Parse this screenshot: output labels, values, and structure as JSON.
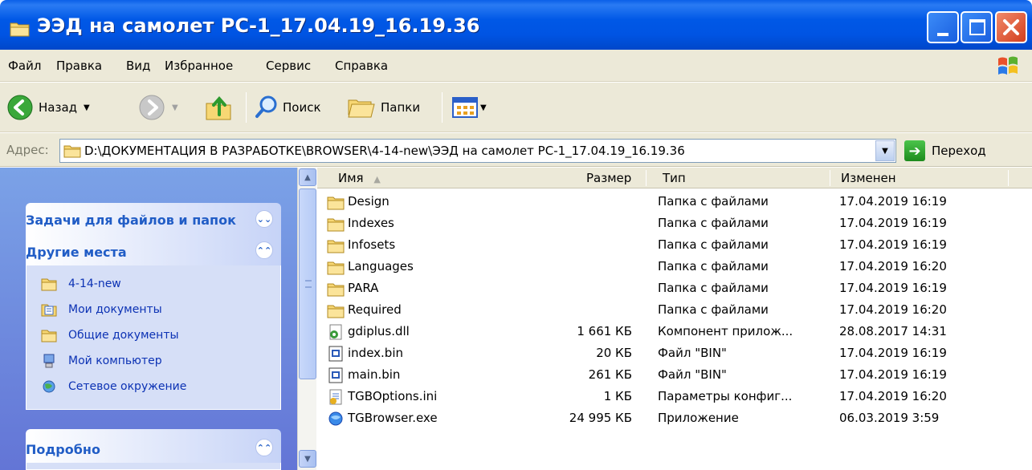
{
  "window": {
    "title": "ЭЭД на самолет РС-1_17.04.19_16.19.36"
  },
  "menu": [
    "Файл",
    "Правка",
    "Вид",
    "Избранное",
    "Сервис",
    "Справка"
  ],
  "toolbar": {
    "back_label": "Назад",
    "search_label": "Поиск",
    "folders_label": "Папки"
  },
  "address": {
    "label": "Адрес:",
    "path": "D:\\ДОКУМЕНТАЦИЯ В РАЗРАБОТКЕ\\BROWSER\\4-14-new\\ЭЭД на самолет РС-1_17.04.19_16.19.36",
    "go_label": "Переход"
  },
  "taskpane": {
    "file_tasks_title": "Задачи для файлов и папок",
    "other_places_title": "Другие места",
    "other_places": [
      {
        "label": "4-14-new",
        "icon": "folder-icon"
      },
      {
        "label": "Мои документы",
        "icon": "my-documents-icon"
      },
      {
        "label": "Общие документы",
        "icon": "folder-icon"
      },
      {
        "label": "Мой компьютер",
        "icon": "my-computer-icon"
      },
      {
        "label": "Сетевое окружение",
        "icon": "network-icon"
      }
    ],
    "details_title": "Подробно"
  },
  "columns": {
    "name": "Имя",
    "size": "Размер",
    "type": "Тип",
    "modified": "Изменен"
  },
  "files": [
    {
      "name": "Design",
      "size": "",
      "type": "Папка с файлами",
      "modified": "17.04.2019 16:19",
      "icon": "folder-icon"
    },
    {
      "name": "Indexes",
      "size": "",
      "type": "Папка с файлами",
      "modified": "17.04.2019 16:19",
      "icon": "folder-icon"
    },
    {
      "name": "Infosets",
      "size": "",
      "type": "Папка с файлами",
      "modified": "17.04.2019 16:19",
      "icon": "folder-icon"
    },
    {
      "name": "Languages",
      "size": "",
      "type": "Папка с файлами",
      "modified": "17.04.2019 16:20",
      "icon": "folder-icon"
    },
    {
      "name": "PARA",
      "size": "",
      "type": "Папка с файлами",
      "modified": "17.04.2019 16:19",
      "icon": "folder-icon"
    },
    {
      "name": "Required",
      "size": "",
      "type": "Папка с файлами",
      "modified": "17.04.2019 16:20",
      "icon": "folder-icon"
    },
    {
      "name": "gdiplus.dll",
      "size": "1 661 КБ",
      "type": "Компонент прилож...",
      "modified": "28.08.2017 14:31",
      "icon": "dll-icon"
    },
    {
      "name": "index.bin",
      "size": "20 КБ",
      "type": "Файл \"BIN\"",
      "modified": "17.04.2019 16:19",
      "icon": "bin-file-icon"
    },
    {
      "name": "main.bin",
      "size": "261 КБ",
      "type": "Файл \"BIN\"",
      "modified": "17.04.2019 16:19",
      "icon": "bin-file-icon"
    },
    {
      "name": "TGBOptions.ini",
      "size": "1 КБ",
      "type": "Параметры конфиг...",
      "modified": "17.04.2019 16:20",
      "icon": "ini-file-icon"
    },
    {
      "name": "TGBrowser.exe",
      "size": "24 995 КБ",
      "type": "Приложение",
      "modified": "06.03.2019 3:59",
      "icon": "exe-icon"
    }
  ]
}
